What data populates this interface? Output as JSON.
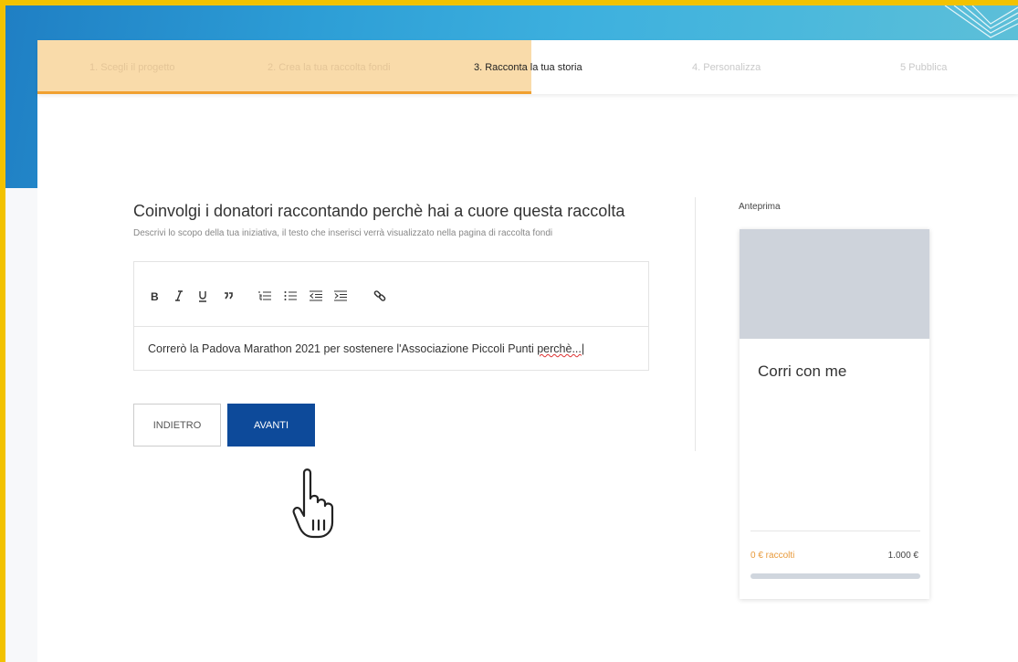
{
  "steps": [
    {
      "label": "1. Scegli il progetto",
      "state": "done"
    },
    {
      "label": "2. Crea la tua raccolta fondi",
      "state": "done"
    },
    {
      "label": "3. Racconta la tua storia",
      "state": "active"
    },
    {
      "label": "4. Personalizza",
      "state": "pending"
    },
    {
      "label": "5 Pubblica",
      "state": "pending"
    }
  ],
  "form": {
    "title": "Coinvolgi i donatori raccontando perchè hai a cuore questa raccolta",
    "subtitle": "Descrivi lo scopo della tua iniziativa, il testo che inserisci verrà visualizzato nella pagina di raccolta fondi",
    "editor_text_main": "Correrò la Padova Marathon 2021 per sostenere l'Associazione Piccoli Punti ",
    "editor_text_misspelled": "perchè...",
    "toolbar_icons": [
      "bold-icon",
      "italic-icon",
      "underline-icon",
      "quote-icon",
      "ordered-list-icon",
      "bullet-list-icon",
      "outdent-icon",
      "indent-icon",
      "link-icon"
    ],
    "back_label": "INDIETRO",
    "next_label": "AVANTI"
  },
  "preview": {
    "label": "Anteprima",
    "title": "Corri con me",
    "raised": "0 € raccolti",
    "goal": "1.000 €",
    "progress_fraction": 0
  },
  "colors": {
    "frame": "#f2c200",
    "accent_orange": "#e89a3b",
    "primary_blue": "#0d4a9a",
    "step_progress": "#f9dbaa"
  }
}
